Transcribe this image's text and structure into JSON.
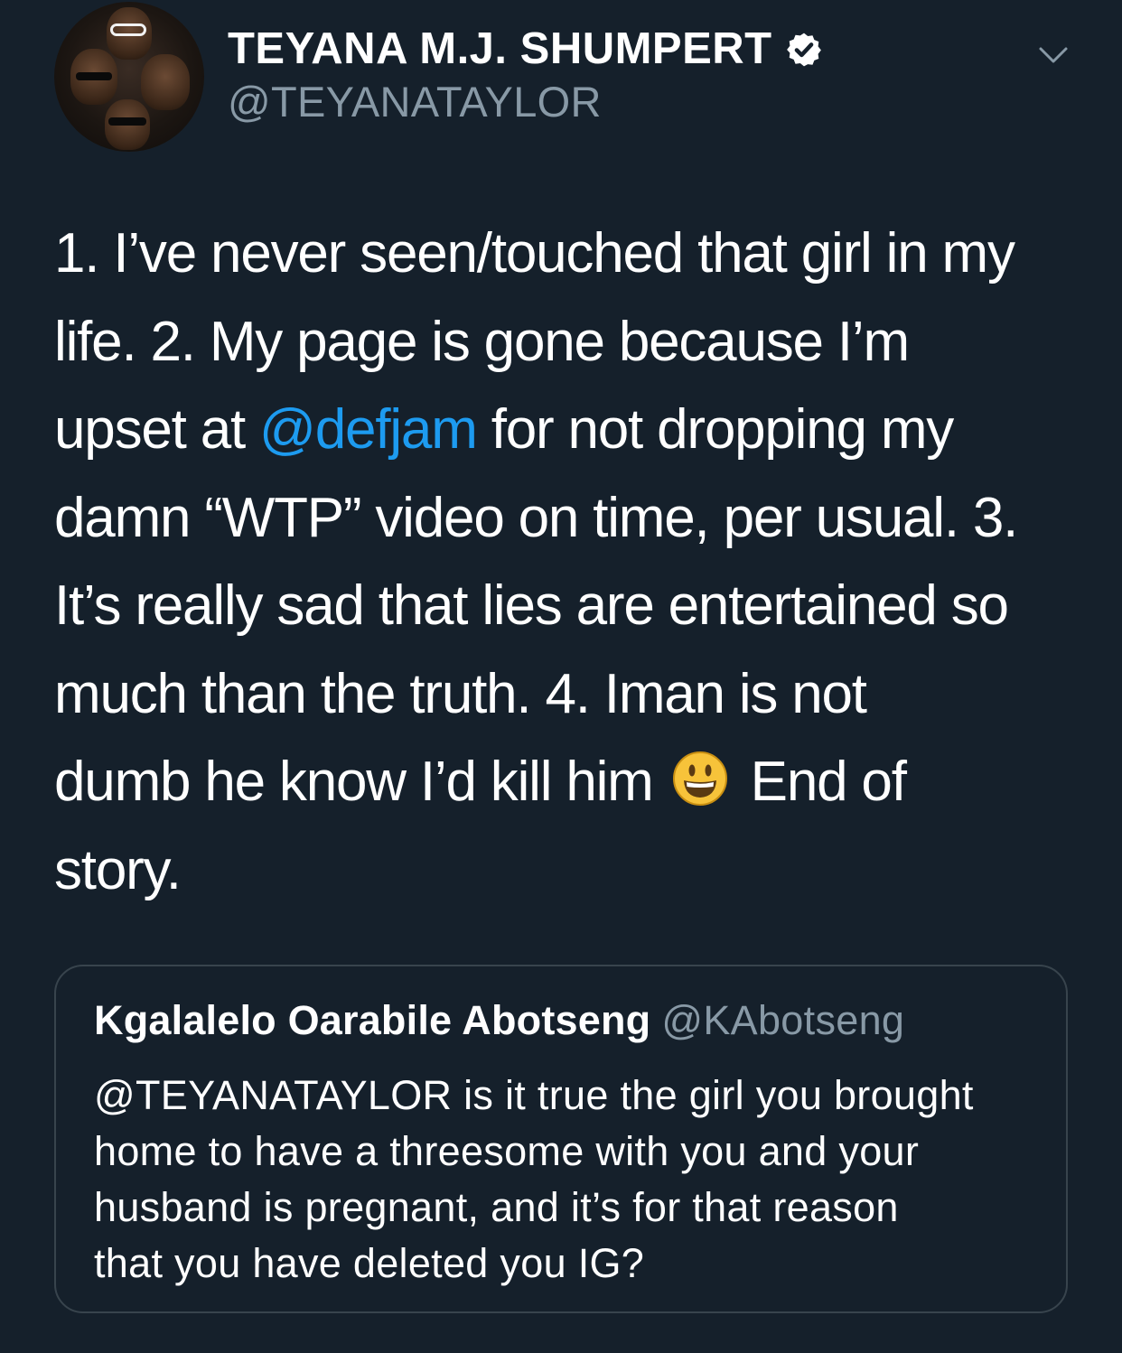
{
  "author": {
    "display_name": "TEYANA M.J. SHUMPERT",
    "handle": "@TEYANATAYLOR",
    "verified": true
  },
  "tweet": {
    "lines": [
      "1. I’ve never seen/touched that girl in my",
      "life. 2. My page is gone because I’m",
      {
        "before": "upset at ",
        "mention": "@defjam",
        "after": " for not dropping my"
      },
      "damn “WTP” video on time, per usual. 3.",
      "It’s really sad that lies are entertained so",
      "much than the truth. 4. Iman is not",
      {
        "before": "dumb he know I’d kill him ",
        "emoji": "grinning-face-emoji",
        "after": " End of"
      },
      "story."
    ]
  },
  "quoted_tweet": {
    "display_name": "Kgalalelo Oarabile Abotseng",
    "handle": "@KAbotseng",
    "lines": [
      "@TEYANATAYLOR is it true the girl you brought",
      "home to have a threesome with you and your",
      "husband is pregnant, and it’s for that reason",
      "that you have deleted you IG?"
    ]
  },
  "icons": {
    "verified": "verified-badge-icon",
    "menu": "chevron-down-icon"
  },
  "colors": {
    "background": "#15202b",
    "text": "#ffffff",
    "secondary_text": "#8899a6",
    "link": "#1d9bf0",
    "border": "#38444d",
    "emoji": "#f7c33a"
  }
}
